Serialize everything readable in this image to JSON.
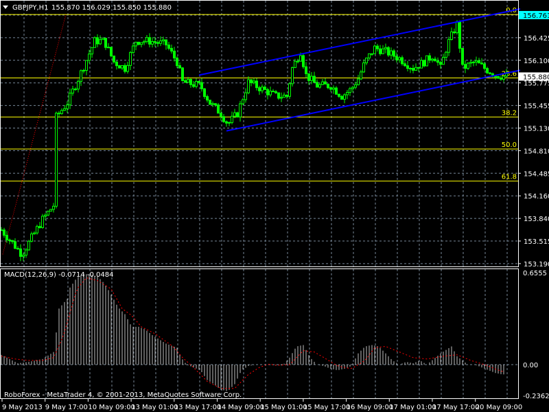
{
  "header": {
    "symbol": "GBPJPY,H1",
    "ohlc": "155.870 156.029 155.850 155.880"
  },
  "colors": {
    "background": "#000000",
    "bull": "#00ff00",
    "bear": "#00ff00",
    "grid": "#778899",
    "channel": "#0000ff",
    "fib": "#ffff00",
    "fib_base": "#ff0000",
    "current_price_bg": "#ffffff",
    "ask_bg": "#00ffff",
    "macd_hist": "#c0c0c0",
    "macd_signal": "#ff0000"
  },
  "price_axis": {
    "labels": [
      "156.761",
      "156.425",
      "156.100",
      "155.775",
      "155.455",
      "155.130",
      "154.810",
      "154.485",
      "154.160",
      "153.840",
      "153.515",
      "153.190"
    ],
    "current": "155.880",
    "ask": "156.761"
  },
  "fib_levels": [
    {
      "label": "0.0",
      "price": 156.77
    },
    {
      "label": "23.6",
      "price": 155.86
    },
    {
      "label": "38.2",
      "price": 155.3
    },
    {
      "label": "50.0",
      "price": 154.84
    },
    {
      "label": "61.8",
      "price": 154.38
    }
  ],
  "channel": {
    "upper": [
      [
        72,
        155.9
      ],
      [
        189,
        156.85
      ]
    ],
    "lower": [
      [
        82,
        155.1
      ],
      [
        189,
        155.97
      ]
    ]
  },
  "price_path": [
    [
      0,
      153.68
    ],
    [
      7.5,
      153.33
    ],
    [
      15,
      153.83
    ],
    [
      19,
      154.03
    ],
    [
      20,
      155.3
    ],
    [
      24,
      155.5
    ],
    [
      27.5,
      155.8
    ],
    [
      34,
      156.39
    ],
    [
      37.5,
      156.39
    ],
    [
      41,
      156.09
    ],
    [
      45,
      156.0
    ],
    [
      49,
      156.39
    ],
    [
      54,
      156.39
    ],
    [
      60,
      156.34
    ],
    [
      64,
      156.09
    ],
    [
      66,
      155.8
    ],
    [
      72.5,
      155.75
    ],
    [
      76,
      155.5
    ],
    [
      80,
      155.35
    ],
    [
      82.5,
      155.2
    ],
    [
      86,
      155.35
    ],
    [
      90,
      155.8
    ],
    [
      95,
      155.7
    ],
    [
      100,
      155.6
    ],
    [
      104,
      155.6
    ],
    [
      106,
      156.0
    ],
    [
      109,
      156.24
    ],
    [
      111,
      155.9
    ],
    [
      115,
      155.75
    ],
    [
      120,
      155.75
    ],
    [
      124,
      155.6
    ],
    [
      127.5,
      155.7
    ],
    [
      130,
      155.85
    ],
    [
      132.5,
      156.09
    ],
    [
      136,
      156.29
    ],
    [
      140,
      156.24
    ],
    [
      145,
      156.14
    ],
    [
      150,
      156.0
    ],
    [
      154,
      156.09
    ],
    [
      157.5,
      156.19
    ],
    [
      160,
      156.0
    ],
    [
      162.5,
      156.34
    ],
    [
      166,
      156.63
    ],
    [
      168,
      156.0
    ],
    [
      172.5,
      156.09
    ],
    [
      176,
      156.0
    ],
    [
      180,
      155.9
    ],
    [
      184,
      155.88
    ]
  ],
  "macd": {
    "title": "MACD(12,26,9) -0.0714 -0.0484",
    "axis_labels": [
      "0.6555",
      "0.00",
      "-0.2362"
    ],
    "histogram": [
      [
        0,
        0.07
      ],
      [
        6,
        0.01
      ],
      [
        10,
        0.02
      ],
      [
        15,
        0.04
      ],
      [
        19,
        0.09
      ],
      [
        20,
        0.23
      ],
      [
        21,
        0.4
      ],
      [
        24,
        0.47
      ],
      [
        25,
        0.55
      ],
      [
        27.5,
        0.62
      ],
      [
        30,
        0.65
      ],
      [
        32.5,
        0.64
      ],
      [
        35,
        0.63
      ],
      [
        37.5,
        0.58
      ],
      [
        40,
        0.5
      ],
      [
        42.5,
        0.41
      ],
      [
        45,
        0.36
      ],
      [
        47.5,
        0.27
      ],
      [
        50,
        0.27
      ],
      [
        52.5,
        0.25
      ],
      [
        55,
        0.21
      ],
      [
        57.5,
        0.18
      ],
      [
        60,
        0.15
      ],
      [
        64,
        0.12
      ],
      [
        65.5,
        0.05
      ],
      [
        67.5,
        0
      ],
      [
        70,
        -0.02
      ],
      [
        72.5,
        -0.04
      ],
      [
        75,
        -0.11
      ],
      [
        77.5,
        -0.14
      ],
      [
        80,
        -0.18
      ],
      [
        82.5,
        -0.19
      ],
      [
        85,
        -0.14
      ],
      [
        87.5,
        -0.04
      ],
      [
        90,
        -0.01
      ],
      [
        92.5,
        0
      ],
      [
        97.5,
        0
      ],
      [
        100,
        -0.005
      ],
      [
        102.5,
        -0.005
      ],
      [
        105,
        0.05
      ],
      [
        107.5,
        0.13
      ],
      [
        110,
        0.14
      ],
      [
        112.5,
        0.05
      ],
      [
        115,
        0
      ],
      [
        117.5,
        -0.01
      ],
      [
        120,
        -0.03
      ],
      [
        122.5,
        -0.04
      ],
      [
        125,
        -0.03
      ],
      [
        127.5,
        -0.01
      ],
      [
        130,
        0.08
      ],
      [
        132.5,
        0.13
      ],
      [
        135,
        0.14
      ],
      [
        137.5,
        0.13
      ],
      [
        140,
        0.08
      ],
      [
        142.5,
        0.03
      ],
      [
        145,
        0
      ],
      [
        147.5,
        0.02
      ],
      [
        150,
        0.01
      ],
      [
        152.5,
        0.03
      ],
      [
        155,
        0
      ],
      [
        157.5,
        0.04
      ],
      [
        160,
        0.08
      ],
      [
        164,
        0.13
      ],
      [
        166,
        0.06
      ],
      [
        170,
        0
      ],
      [
        172.5,
        0
      ],
      [
        175,
        -0.02
      ],
      [
        177.5,
        -0.04
      ],
      [
        180,
        -0.06
      ],
      [
        182.5,
        -0.07
      ]
    ],
    "signal": [
      [
        0,
        0.06
      ],
      [
        5,
        0.04
      ],
      [
        10,
        0.03
      ],
      [
        15,
        0.03
      ],
      [
        19,
        0.05
      ],
      [
        22.5,
        0.2
      ],
      [
        25,
        0.37
      ],
      [
        27.5,
        0.54
      ],
      [
        31,
        0.62
      ],
      [
        35,
        0.6
      ],
      [
        40,
        0.54
      ],
      [
        44,
        0.4
      ],
      [
        47.5,
        0.35
      ],
      [
        51,
        0.27
      ],
      [
        56,
        0.22
      ],
      [
        62.5,
        0.13
      ],
      [
        66,
        0.05
      ],
      [
        70,
        -0.02
      ],
      [
        75,
        -0.12
      ],
      [
        80,
        -0.17
      ],
      [
        85,
        -0.17
      ],
      [
        90,
        -0.07
      ],
      [
        94,
        -0.02
      ],
      [
        97.5,
        0.005
      ],
      [
        100,
        -0.005
      ],
      [
        105,
        0
      ],
      [
        110,
        0.1
      ],
      [
        114,
        0.09
      ],
      [
        117.5,
        0.05
      ],
      [
        122.5,
        -0.01
      ],
      [
        127.5,
        -0.03
      ],
      [
        132.5,
        0.03
      ],
      [
        136,
        0.12
      ],
      [
        140,
        0.13
      ],
      [
        145,
        0.09
      ],
      [
        150,
        0.05
      ],
      [
        155,
        0.04
      ],
      [
        161,
        0.06
      ],
      [
        166,
        0.07
      ],
      [
        171,
        0.03
      ],
      [
        176,
        0
      ],
      [
        182.5,
        -0.05
      ]
    ]
  },
  "copyright": "RoboForex - MetaTrader 4, © 2001-2013, MetaQuotes Software Corp.",
  "time_axis": [
    "9 May 2013",
    "9 May 17:00",
    "10 May 09:00",
    "13 May 01:00",
    "13 May 17:00",
    "14 May 09:00",
    "15 May 01:00",
    "15 May 17:00",
    "16 May 09:00",
    "17 May 01:00",
    "17 May 17:00",
    "20 May 09:00"
  ]
}
